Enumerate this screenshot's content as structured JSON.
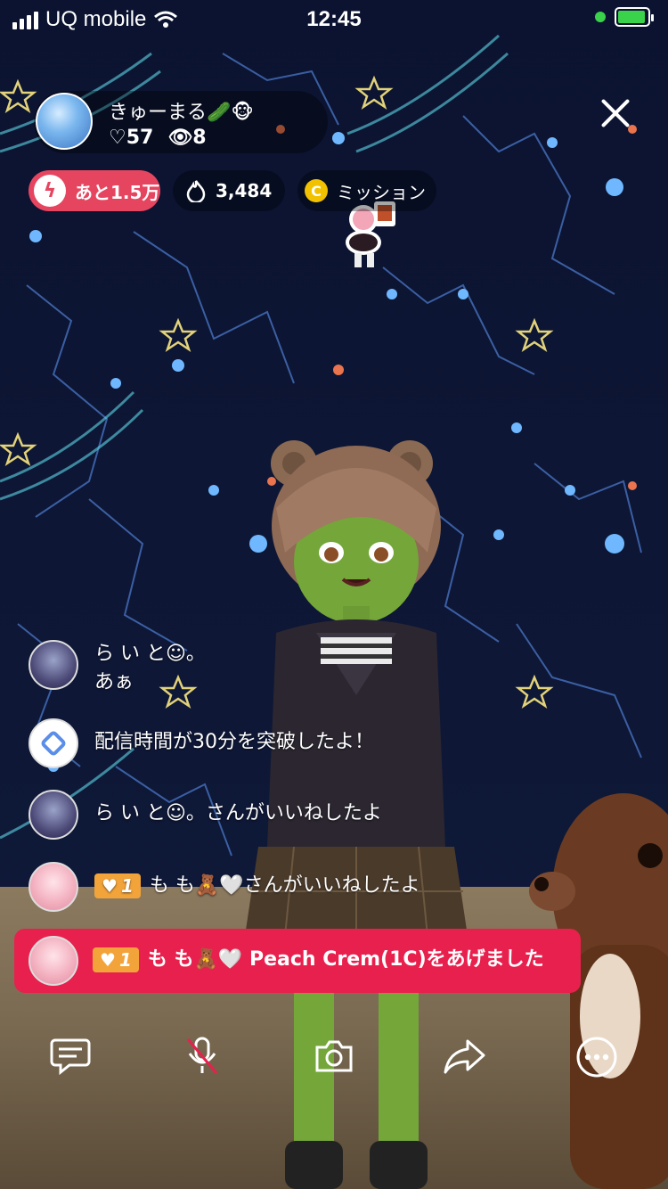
{
  "status_bar": {
    "carrier": "UQ mobile",
    "time": "12:45"
  },
  "host": {
    "name": "きゅーまる🥒🐵",
    "likes": "♡57",
    "viewers": "👁8"
  },
  "pills": {
    "remaining": "あと1.5万",
    "fire_count": "3,484",
    "mission_coin": "C",
    "mission_label": "ミッション"
  },
  "chat": [
    {
      "line1": "ら い と☺。",
      "line2": "あぁ"
    },
    {
      "text": "配信時間が30分を突破したよ！"
    },
    {
      "text": "ら い と☺。さんがいいねしたよ"
    },
    {
      "badge": "1",
      "text": "も も🧸🤍さんがいいねしたよ"
    }
  ],
  "gift": {
    "badge": "1",
    "text": "も も🧸🤍 Peach Crem(1C)をあげました"
  },
  "toolbar": {
    "comment": "comment-icon",
    "mic": "mic-off-icon",
    "camera": "camera-icon",
    "share": "share-icon",
    "more": "more-icon"
  },
  "colors": {
    "accent_red": "#e8204d",
    "pill_red": "#e64560",
    "badge_orange": "#f2a43a",
    "coin_yellow": "#f2c200"
  }
}
